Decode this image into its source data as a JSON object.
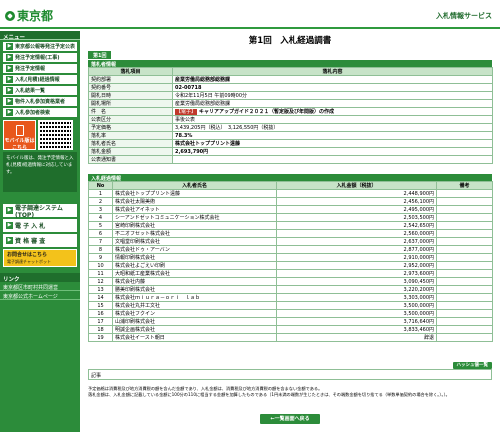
{
  "header": {
    "logo_text": "東京都",
    "service_title": "入札情報サービス"
  },
  "sidebar": {
    "menu_title": "メニュー",
    "items": [
      {
        "label": "東京都公報等発注予定公表"
      },
      {
        "label": "発注予定情報(工事)"
      },
      {
        "label": "発注予定情報"
      },
      {
        "label": "入札(見積)経過情報"
      },
      {
        "label": "入札結果一覧"
      },
      {
        "label": "物件入札参加資格業者"
      },
      {
        "label": "入札参加者検索"
      }
    ],
    "mobile_label": "モバイル版はこちら",
    "mobile_note": "モバイル版は、発注予定情報と入札(見積)経過情報に対応しています。",
    "sub_items": [
      {
        "label": "電子調達システム(TOP)"
      },
      {
        "label": "電 子 入 札"
      },
      {
        "label": "資 格 審 査"
      }
    ],
    "chat_label": "お問合せはこちら",
    "chat_sub": "電子調達チャットボット",
    "links_title": "リンク",
    "links": [
      {
        "label": "東京都区市町村共同運営"
      },
      {
        "label": "東京都公式ホームページ"
      }
    ]
  },
  "main": {
    "title": "第1回　入札経過調書",
    "tab": "第1回",
    "info_title": "落札者情報",
    "info_headers": {
      "item": "落札項目",
      "content": "落札内容"
    },
    "info_rows": [
      {
        "label": "契約部署",
        "value": "産業労働局総務部総務課",
        "bold": true
      },
      {
        "label": "契約番号",
        "value": "02-00718",
        "bold": true
      },
      {
        "label": "開札日時",
        "value": "令和2年11月5日 午前09時00分",
        "bold": false
      },
      {
        "label": "開札場所",
        "value": "産業労働局総務部総務課",
        "bold": false
      },
      {
        "label": "件　名",
        "tag": "【電子】",
        "value": "キャリアアップガイド２０２１（暫定版及び年間版）の作成",
        "bold": true
      },
      {
        "label": "公表区分",
        "value": "事後公表",
        "bold": false
      },
      {
        "label": "予定価格",
        "value": "3,439,205円（税込）　3,126,550円（税抜）",
        "bold": false
      },
      {
        "label": "落札率",
        "value": "78.3%",
        "bold": true
      },
      {
        "label": "落札者氏名",
        "value": "株式会社トッププリント遠藤",
        "bold": true
      },
      {
        "label": "落札金額",
        "value": "2,693,790円",
        "bold": true
      },
      {
        "label": "公表通知書",
        "value": "",
        "bold": false
      }
    ],
    "bid_title": "入札経過情報",
    "bid_headers": {
      "no": "No",
      "name": "入札者氏名",
      "amount": "入札金額（税抜）",
      "remark": "備考"
    },
    "bids": [
      {
        "no": "1",
        "name": "株式会社トッププリント遠藤",
        "amount": "2,448,900円",
        "remark": ""
      },
      {
        "no": "2",
        "name": "株式会社太陽美術",
        "amount": "2,456,100円",
        "remark": ""
      },
      {
        "no": "3",
        "name": "株式会社アイネット",
        "amount": "2,495,000円",
        "remark": ""
      },
      {
        "no": "4",
        "name": "シーアンドゼットコミュニケーション株式会社",
        "amount": "2,503,500円",
        "remark": ""
      },
      {
        "no": "5",
        "name": "宮崎印刷株式会社",
        "amount": "2,542,650円",
        "remark": ""
      },
      {
        "no": "6",
        "name": "不二オフセット株式会社",
        "amount": "2,560,000円",
        "remark": ""
      },
      {
        "no": "7",
        "name": "文唱堂印刷株式会社",
        "amount": "2,637,000円",
        "remark": ""
      },
      {
        "no": "8",
        "name": "株式会社ドゥ・アーバン",
        "amount": "2,877,000円",
        "remark": ""
      },
      {
        "no": "9",
        "name": "情報印刷株式会社",
        "amount": "2,910,000円",
        "remark": ""
      },
      {
        "no": "10",
        "name": "株式会社よごえい印刷",
        "amount": "2,952,000円",
        "remark": ""
      },
      {
        "no": "11",
        "name": "大昭和紙工産業株式会社",
        "amount": "2,973,600円",
        "remark": ""
      },
      {
        "no": "12",
        "name": "株式会社内藤",
        "amount": "3,090,450円",
        "remark": ""
      },
      {
        "no": "13",
        "name": "勝美印刷株式会社",
        "amount": "3,220,200円",
        "remark": ""
      },
      {
        "no": "14",
        "name": "株式会社ｍｉｕｒａ－ｏｒｉ　ｌａｂ",
        "amount": "3,303,000円",
        "remark": ""
      },
      {
        "no": "15",
        "name": "株式会社丸井工文社",
        "amount": "3,500,000円",
        "remark": ""
      },
      {
        "no": "16",
        "name": "株式会社フクイン",
        "amount": "3,500,000円",
        "remark": ""
      },
      {
        "no": "17",
        "name": "山浦印刷株式会社",
        "amount": "3,716,640円",
        "remark": ""
      },
      {
        "no": "18",
        "name": "明誠企画株式会社",
        "amount": "3,833,460円",
        "remark": ""
      },
      {
        "no": "19",
        "name": "株式会社イースト朝日",
        "amount": "辞退",
        "remark": ""
      }
    ],
    "history_button": "ハッシュ値一覧",
    "remarks_label": "記事",
    "notes": [
      "予定価格は消費税及び地方消費税の額を含んだ金額であり、入札金額は、消費税及び地方消費税の額を含まない金額である。",
      "落札金額は、入札金額に記載している金額に100分の110に相当する金額を加算したものである（1円未満の端数が生じたときは、その端数金額を切り捨てる（単数単価契約の場合を除く。）。）。"
    ],
    "back_button": "←一覧画面へ戻る"
  }
}
